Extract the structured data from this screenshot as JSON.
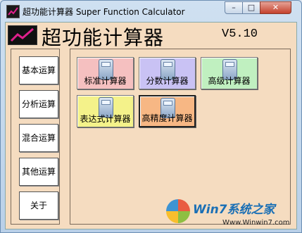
{
  "window": {
    "title": "超功能计算器 Super Function Calculator",
    "minimize_glyph": "–",
    "maximize_glyph": "□",
    "close_glyph": "✕"
  },
  "header": {
    "title": "超功能计算器",
    "version": "V5.10"
  },
  "sidebar": {
    "items": [
      {
        "label": "基本运算"
      },
      {
        "label": "分析运算"
      },
      {
        "label": "混合运算"
      },
      {
        "label": "其他运算"
      },
      {
        "label": "关于"
      }
    ]
  },
  "calculators": [
    {
      "label": "标准计算器",
      "color": "#f5c0c0",
      "icon": "calculator-icon"
    },
    {
      "label": "分数计算器",
      "color": "#c9c2f4",
      "icon": "fraction-calculator-icon"
    },
    {
      "label": "高级计算器",
      "color": "#c0f0c0",
      "icon": "calculator-icon"
    },
    {
      "label": "表达式计算器",
      "color": "#f4f28a",
      "icon": "calculator-icon"
    },
    {
      "label": "高精度计算器",
      "color": "#f7b784",
      "icon": "calculator-icon"
    }
  ],
  "watermark": {
    "brand": "Win7系统之家",
    "url": "Www.Winwin7.com"
  }
}
